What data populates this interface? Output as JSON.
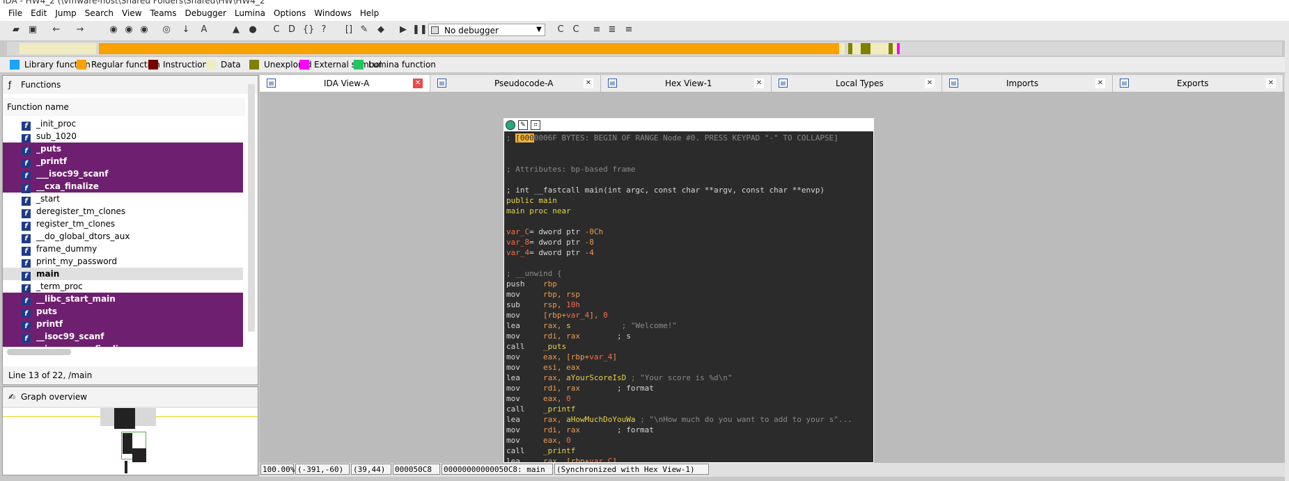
{
  "window": {
    "title": "IDA - HW4_2 (\\vmware-host\\Shared Folders\\Shared\\HW\\HW4_2"
  },
  "menu": [
    "File",
    "Edit",
    "Jump",
    "Search",
    "View",
    "Teams",
    "Debugger",
    "Lumina",
    "Options",
    "Windows",
    "Help"
  ],
  "toolbar": {
    "debugger_select": "No debugger"
  },
  "legend": [
    {
      "label": "Library function",
      "color": "#1aa3ff"
    },
    {
      "label": "Regular function",
      "color": "#f7a200"
    },
    {
      "label": "Instruction",
      "color": "#7a0000"
    },
    {
      "label": "Data",
      "color": "#f0ecbf"
    },
    {
      "label": "Unexplored",
      "color": "#808000"
    },
    {
      "label": "External symbol",
      "color": "#ff00ff"
    },
    {
      "label": "Lumina function",
      "color": "#22c55e"
    }
  ],
  "functions": {
    "title": "Functions",
    "column": "Function name",
    "items": [
      {
        "name": "_init_proc",
        "style": "normal"
      },
      {
        "name": "sub_1020",
        "style": "normal"
      },
      {
        "name": "_puts",
        "style": "lib"
      },
      {
        "name": "_printf",
        "style": "lib"
      },
      {
        "name": "___isoc99_scanf",
        "style": "lib"
      },
      {
        "name": "__cxa_finalize",
        "style": "lib"
      },
      {
        "name": "_start",
        "style": "normal"
      },
      {
        "name": "deregister_tm_clones",
        "style": "normal"
      },
      {
        "name": "register_tm_clones",
        "style": "normal"
      },
      {
        "name": "__do_global_dtors_aux",
        "style": "normal"
      },
      {
        "name": "frame_dummy",
        "style": "normal"
      },
      {
        "name": "print_my_password",
        "style": "normal"
      },
      {
        "name": "main",
        "style": "sel"
      },
      {
        "name": "_term_proc",
        "style": "normal"
      },
      {
        "name": "__libc_start_main",
        "style": "lib"
      },
      {
        "name": "puts",
        "style": "lib"
      },
      {
        "name": "printf",
        "style": "lib"
      },
      {
        "name": "__isoc99_scanf",
        "style": "lib"
      },
      {
        "name": "__imp___cxa_finalize",
        "style": "lib"
      }
    ],
    "status": "Line 13 of 22, /main"
  },
  "graph_overview": {
    "title": "Graph overview"
  },
  "tabs": [
    {
      "label": "IDA View-A",
      "active": true
    },
    {
      "label": "Pseudocode-A",
      "active": false
    },
    {
      "label": "Hex View-1",
      "active": false
    },
    {
      "label": "Local Types",
      "active": false
    },
    {
      "label": "Imports",
      "active": false
    },
    {
      "label": "Exports",
      "active": false
    }
  ],
  "code_lines": [
    [
      [
        "; ",
        "c-cmt"
      ],
      [
        "[000",
        "c-hl"
      ],
      [
        "0006F BYTES: BEGIN OF RANGE Node #0. PRESS KEYPAD \"-\" TO COLLAPSE]",
        "c-cmt"
      ]
    ],
    [],
    [],
    [
      [
        "; Attributes: bp-based frame",
        "c-cmt"
      ]
    ],
    [],
    [
      [
        "; int __fastcall main(int argc, const char **argv, const char **envp)",
        ""
      ]
    ],
    [
      [
        "public main",
        "c-yel"
      ]
    ],
    [
      [
        "main proc near",
        "c-yel"
      ]
    ],
    [],
    [
      [
        "var_C",
        "c-red"
      ],
      [
        "= dword ptr ",
        ""
      ],
      [
        "-0Ch",
        "c-org"
      ]
    ],
    [
      [
        "var_8",
        "c-red"
      ],
      [
        "= dword ptr ",
        ""
      ],
      [
        "-8",
        "c-org"
      ]
    ],
    [
      [
        "var_4",
        "c-red"
      ],
      [
        "= dword ptr ",
        ""
      ],
      [
        "-4",
        "c-org"
      ]
    ],
    [],
    [
      [
        "; __unwind {",
        "c-cmt"
      ]
    ],
    [
      [
        "push    ",
        ""
      ],
      [
        "rbp",
        "c-org"
      ]
    ],
    [
      [
        "mov     ",
        ""
      ],
      [
        "rbp, rsp",
        "c-org"
      ]
    ],
    [
      [
        "sub     ",
        ""
      ],
      [
        "rsp, ",
        "c-org"
      ],
      [
        "10h",
        "c-red"
      ]
    ],
    [
      [
        "mov     ",
        ""
      ],
      [
        "[rbp+",
        "c-org"
      ],
      [
        "var_4",
        "c-red"
      ],
      [
        "], ",
        "c-org"
      ],
      [
        "0",
        "c-red"
      ]
    ],
    [
      [
        "lea     ",
        ""
      ],
      [
        "rax, ",
        "c-org"
      ],
      [
        "s",
        "c-yel"
      ],
      [
        "           ; \"Welcome!\"",
        "c-cmt"
      ]
    ],
    [
      [
        "mov     ",
        ""
      ],
      [
        "rdi, rax",
        "c-org"
      ],
      [
        "        ; s",
        ""
      ]
    ],
    [
      [
        "call    ",
        ""
      ],
      [
        "_puts",
        "c-yel"
      ]
    ],
    [
      [
        "mov     ",
        ""
      ],
      [
        "eax, [rbp+",
        "c-org"
      ],
      [
        "var_4",
        "c-red"
      ],
      [
        "]",
        "c-org"
      ]
    ],
    [
      [
        "mov     ",
        ""
      ],
      [
        "esi, eax",
        "c-org"
      ]
    ],
    [
      [
        "lea     ",
        ""
      ],
      [
        "rax, ",
        "c-org"
      ],
      [
        "aYourScoreIsD",
        "c-yel"
      ],
      [
        " ; \"Your score is %d\\n\"",
        "c-cmt"
      ]
    ],
    [
      [
        "mov     ",
        ""
      ],
      [
        "rdi, rax",
        "c-org"
      ],
      [
        "        ; format",
        ""
      ]
    ],
    [
      [
        "mov     ",
        ""
      ],
      [
        "eax, ",
        "c-org"
      ],
      [
        "0",
        "c-red"
      ]
    ],
    [
      [
        "call    ",
        ""
      ],
      [
        "_printf",
        "c-yel"
      ]
    ],
    [
      [
        "lea     ",
        ""
      ],
      [
        "rax, ",
        "c-org"
      ],
      [
        "aHowMuchDoYouWa",
        "c-yel"
      ],
      [
        " ; \"\\nHow much do you want to add to your s\"...",
        "c-cmt"
      ]
    ],
    [
      [
        "mov     ",
        ""
      ],
      [
        "rdi, rax",
        "c-org"
      ],
      [
        "        ; format",
        ""
      ]
    ],
    [
      [
        "mov     ",
        ""
      ],
      [
        "eax, ",
        "c-org"
      ],
      [
        "0",
        "c-red"
      ]
    ],
    [
      [
        "call    ",
        ""
      ],
      [
        "_printf",
        "c-yel"
      ]
    ],
    [
      [
        "lea     ",
        ""
      ],
      [
        "rax, [rbp+",
        "c-org"
      ],
      [
        "var_C",
        "c-red"
      ],
      [
        "]",
        "c-org"
      ]
    ]
  ],
  "status": {
    "zoom": "100.00%",
    "coords": "(-391,-60)",
    "pos": "(39,44)",
    "offset": "000050C8",
    "addr": "00000000000050C8: main",
    "sync": "(Synchronized with Hex View-1)"
  }
}
